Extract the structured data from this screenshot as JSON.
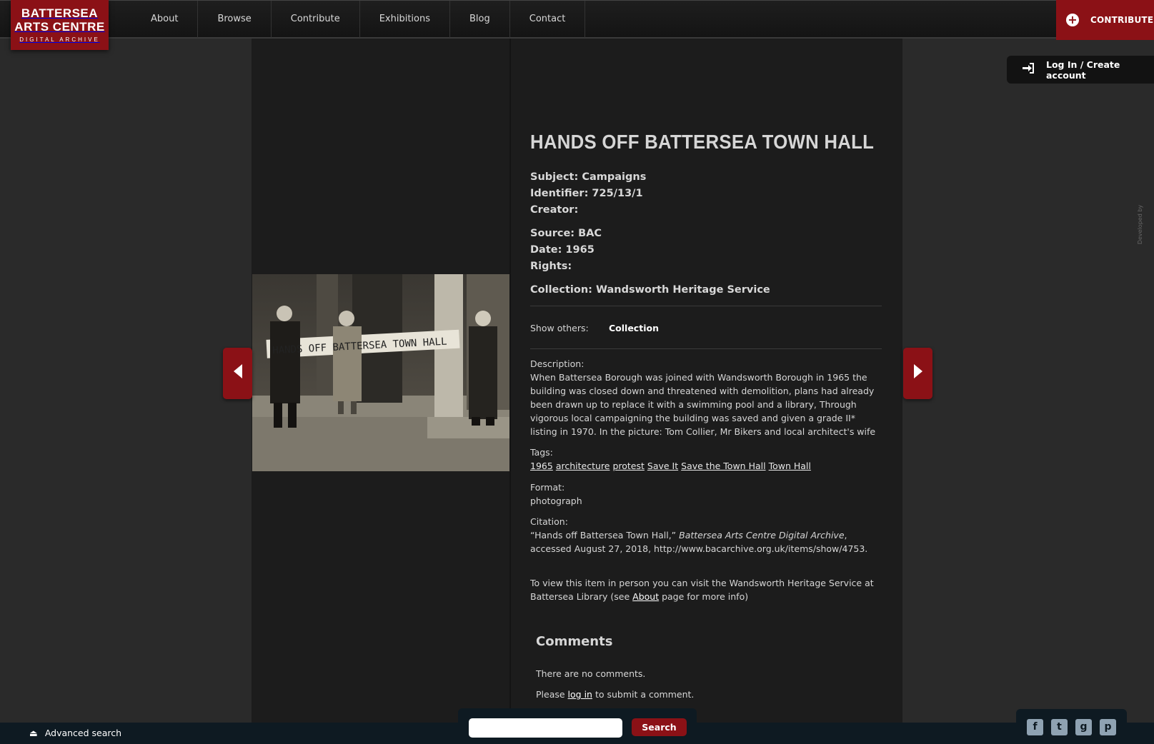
{
  "header": {
    "logo": {
      "line1": "BATTERSEA",
      "line2": "ARTS CENTRE",
      "line3": "DIGITAL ARCHIVE"
    },
    "nav": [
      "About",
      "Browse",
      "Contribute",
      "Exhibitions",
      "Blog",
      "Contact"
    ],
    "contribute_label": "CONTRIBUTE",
    "login_label": "Log In / Create account"
  },
  "item": {
    "title": "HANDS OFF BATTERSEA TOWN HALL",
    "subject": "Subject: Campaigns",
    "identifier": "Identifier: 725/13/1",
    "creator": "Creator:",
    "source": "Source: BAC",
    "date": "Date: 1965",
    "rights": "Rights:",
    "collection": "Collection: Wandsworth Heritage Service",
    "show_others_label": "Show others:",
    "show_others_value": "Collection",
    "description_label": "Description:",
    "description": "When Battersea Borough was joined with Wandsworth Borough in 1965 the building was closed down and threatened with demolition, plans had already been drawn up to replace it with a swimming pool and a library, Through vigorous local campaigning the building was saved and given a grade II* listing in 1970. In the picture: Tom Collier, Mr Bikers and local architect's wife",
    "tags_label": "Tags:",
    "tags": [
      "1965",
      "architecture",
      "protest",
      "Save It",
      "Save the Town Hall",
      "Town Hall"
    ],
    "format_label": "Format:",
    "format": "photograph",
    "citation_label": "Citation:",
    "citation_pre": "“Hands off Battersea Town Hall,” ",
    "citation_italic": "Battersea Arts Centre Digital Archive",
    "citation_post": ", accessed August 27, 2018, http://www.bacarchive.org.uk/items/show/4753.",
    "visit_pre": "To view this item in person you can visit the Wandsworth Heritage Service at Battersea Library (see ",
    "visit_link": "About",
    "visit_post": " page for more info)",
    "photo_banner": "HANDS OFF BATTERSEA TOWN HALL"
  },
  "comments": {
    "heading": "Comments",
    "none": "There are no comments.",
    "login_pre": "Please ",
    "login_link": "log in",
    "login_post": " to submit a comment."
  },
  "footer": {
    "advanced_search": "Advanced search",
    "search_button": "Search",
    "developed_by": "Developed by"
  },
  "colors": {
    "accent": "#8b1116",
    "background": "#2a2a2a",
    "panel": "#1c1c1c"
  }
}
